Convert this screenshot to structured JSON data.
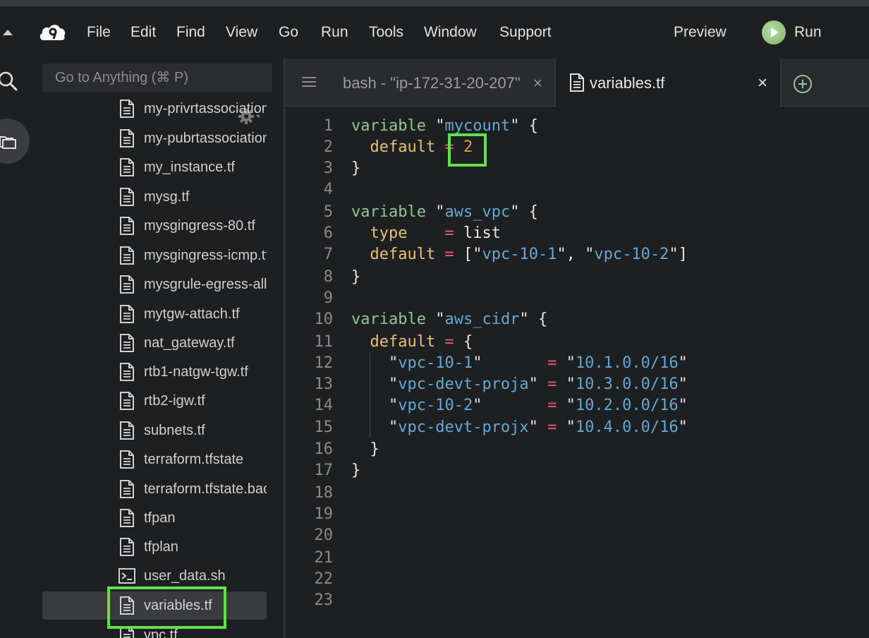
{
  "menubar": {
    "items": [
      "File",
      "Edit",
      "Find",
      "View",
      "Go",
      "Run",
      "Tools",
      "Window",
      "Support"
    ],
    "preview_label": "Preview",
    "run_label": "Run"
  },
  "sidebar": {
    "goto_placeholder": "Go to Anything (⌘ P)",
    "files": [
      {
        "name": "my-privrtassociation",
        "icon": "file-icon"
      },
      {
        "name": "my-pubrtassociation",
        "icon": "file-icon"
      },
      {
        "name": "my_instance.tf",
        "icon": "file-icon"
      },
      {
        "name": "mysg.tf",
        "icon": "file-icon"
      },
      {
        "name": "mysgingress-80.tf",
        "icon": "file-icon"
      },
      {
        "name": "mysgingress-icmp.tf",
        "icon": "file-icon"
      },
      {
        "name": "mysgrule-egress-all",
        "icon": "file-icon"
      },
      {
        "name": "mytgw-attach.tf",
        "icon": "file-icon"
      },
      {
        "name": "nat_gateway.tf",
        "icon": "file-icon"
      },
      {
        "name": "rtb1-natgw-tgw.tf",
        "icon": "file-icon"
      },
      {
        "name": "rtb2-igw.tf",
        "icon": "file-icon"
      },
      {
        "name": "subnets.tf",
        "icon": "file-icon"
      },
      {
        "name": "terraform.tfstate",
        "icon": "file-icon"
      },
      {
        "name": "terraform.tfstate.backup",
        "icon": "file-icon"
      },
      {
        "name": "tfpan",
        "icon": "file-icon"
      },
      {
        "name": "tfplan",
        "icon": "file-icon"
      },
      {
        "name": "user_data.sh",
        "icon": "terminal-icon"
      },
      {
        "name": "variables.tf",
        "icon": "file-icon",
        "selected": true
      },
      {
        "name": "vpc.tf",
        "icon": "file-icon"
      }
    ]
  },
  "tabs": {
    "bash_label": "bash - \"ip-172-31-20-207\"",
    "bash_close": "×",
    "active_label": "variables.tf",
    "active_close": "×"
  },
  "editor": {
    "lines": [
      {
        "n": "1",
        "tokens": [
          [
            "kw",
            "variable"
          ],
          [
            "pl",
            " \""
          ],
          [
            "str",
            "mycount"
          ],
          [
            "pl",
            "\" {"
          ]
        ]
      },
      {
        "n": "2",
        "tokens": [
          [
            "pl",
            "  "
          ],
          [
            "attr",
            "default"
          ],
          [
            "pl",
            " "
          ],
          [
            "op",
            "="
          ],
          [
            "pl",
            " "
          ],
          [
            "num",
            "2"
          ]
        ]
      },
      {
        "n": "3",
        "tokens": [
          [
            "pl",
            "}"
          ]
        ]
      },
      {
        "n": "4",
        "tokens": []
      },
      {
        "n": "5",
        "tokens": [
          [
            "kw",
            "variable"
          ],
          [
            "pl",
            " \""
          ],
          [
            "str",
            "aws_vpc"
          ],
          [
            "pl",
            "\" {"
          ]
        ]
      },
      {
        "n": "6",
        "tokens": [
          [
            "pl",
            "  "
          ],
          [
            "attr",
            "type"
          ],
          [
            "pl",
            "    "
          ],
          [
            "op",
            "="
          ],
          [
            "pl",
            " list"
          ]
        ]
      },
      {
        "n": "7",
        "tokens": [
          [
            "pl",
            "  "
          ],
          [
            "attr",
            "default"
          ],
          [
            "pl",
            " "
          ],
          [
            "op",
            "="
          ],
          [
            "pl",
            " [\""
          ],
          [
            "str",
            "vpc-10-1"
          ],
          [
            "pl",
            "\", \""
          ],
          [
            "str",
            "vpc-10-2"
          ],
          [
            "pl",
            "\"]"
          ]
        ]
      },
      {
        "n": "8",
        "tokens": [
          [
            "pl",
            "}"
          ]
        ]
      },
      {
        "n": "9",
        "tokens": []
      },
      {
        "n": "10",
        "tokens": [
          [
            "kw",
            "variable"
          ],
          [
            "pl",
            " \""
          ],
          [
            "str",
            "aws_cidr"
          ],
          [
            "pl",
            "\" {"
          ]
        ]
      },
      {
        "n": "11",
        "tokens": [
          [
            "pl",
            "  "
          ],
          [
            "attr",
            "default"
          ],
          [
            "pl",
            " "
          ],
          [
            "op",
            "="
          ],
          [
            "pl",
            " {"
          ]
        ]
      },
      {
        "n": "12",
        "tokens": [
          [
            "pl",
            "    \""
          ],
          [
            "str",
            "vpc-10-1"
          ],
          [
            "pl",
            "\"       "
          ],
          [
            "op",
            "="
          ],
          [
            "pl",
            " \""
          ],
          [
            "str",
            "10.1.0.0/16"
          ],
          [
            "pl",
            "\""
          ]
        ]
      },
      {
        "n": "13",
        "tokens": [
          [
            "pl",
            "    \""
          ],
          [
            "str",
            "vpc-devt-proja"
          ],
          [
            "pl",
            "\" "
          ],
          [
            "op",
            "="
          ],
          [
            "pl",
            " \""
          ],
          [
            "str",
            "10.3.0.0/16"
          ],
          [
            "pl",
            "\""
          ]
        ]
      },
      {
        "n": "14",
        "tokens": [
          [
            "pl",
            "    \""
          ],
          [
            "str",
            "vpc-10-2"
          ],
          [
            "pl",
            "\"       "
          ],
          [
            "op",
            "="
          ],
          [
            "pl",
            " \""
          ],
          [
            "str",
            "10.2.0.0/16"
          ],
          [
            "pl",
            "\""
          ]
        ]
      },
      {
        "n": "15",
        "tokens": [
          [
            "pl",
            "    \""
          ],
          [
            "str",
            "vpc-devt-projx"
          ],
          [
            "pl",
            "\" "
          ],
          [
            "op",
            "="
          ],
          [
            "pl",
            " \""
          ],
          [
            "str",
            "10.4.0.0/16"
          ],
          [
            "pl",
            "\""
          ]
        ]
      },
      {
        "n": "16",
        "tokens": [
          [
            "pl",
            "  }"
          ]
        ]
      },
      {
        "n": "17",
        "tokens": [
          [
            "pl",
            "}"
          ]
        ]
      },
      {
        "n": "18",
        "tokens": []
      },
      {
        "n": "19",
        "tokens": []
      },
      {
        "n": "20",
        "tokens": []
      },
      {
        "n": "21",
        "tokens": []
      },
      {
        "n": "22",
        "tokens": []
      },
      {
        "n": "23",
        "tokens": []
      }
    ]
  },
  "colors": {
    "highlight": "#5fe24d",
    "keyword": "#8fc79a",
    "attribute": "#e5c07b",
    "string": "#63a9d6",
    "operator": "#e05d6f",
    "number": "#e39a4a"
  }
}
